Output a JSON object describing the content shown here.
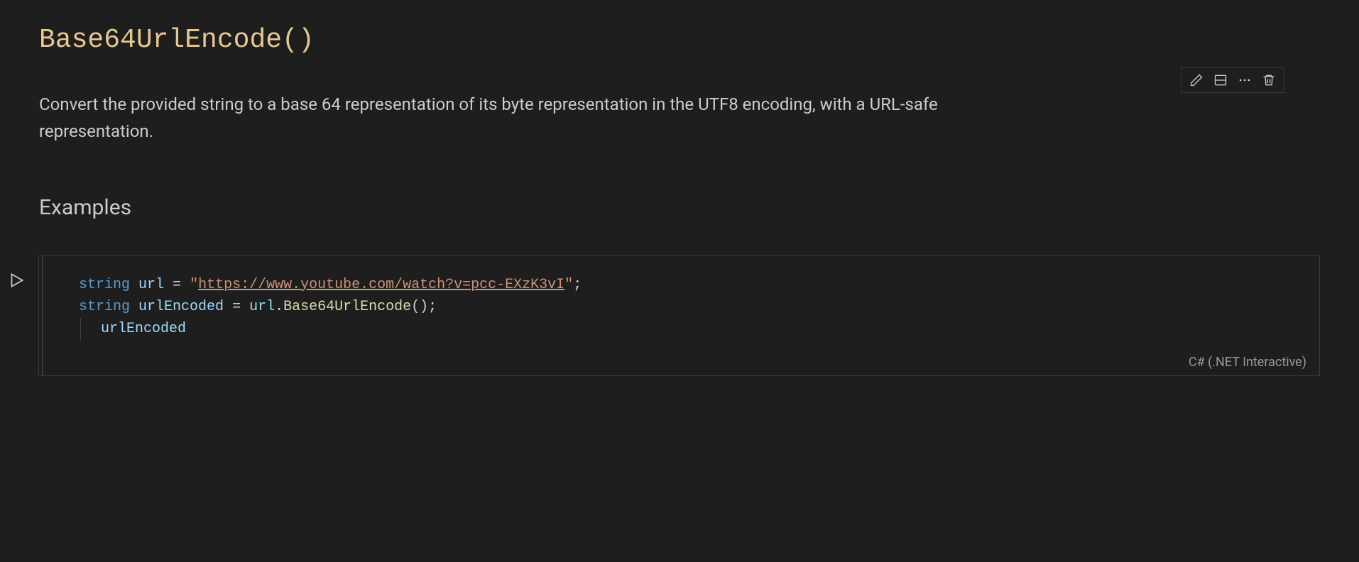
{
  "title": "Base64UrlEncode()",
  "description": "Convert the provided string to a base 64 representation of its byte representation in the UTF8 encoding, with a URL-safe representation.",
  "section_heading": "Examples",
  "code": {
    "lines": [
      {
        "kw1": "string",
        "var1": "url",
        "op1": " = ",
        "q1": "\"",
        "str": "https://www.youtube.com/watch?v=pcc-EXzK3vI",
        "q2": "\"",
        "end": ";"
      },
      {
        "kw1": "string",
        "var1": "urlEncoded",
        "op1": " = ",
        "var2": "url",
        "dot": ".",
        "method": "Base64UrlEncode",
        "call": "();"
      },
      {
        "var": "urlEncoded"
      }
    ],
    "language": "C# (.NET Interactive)"
  }
}
